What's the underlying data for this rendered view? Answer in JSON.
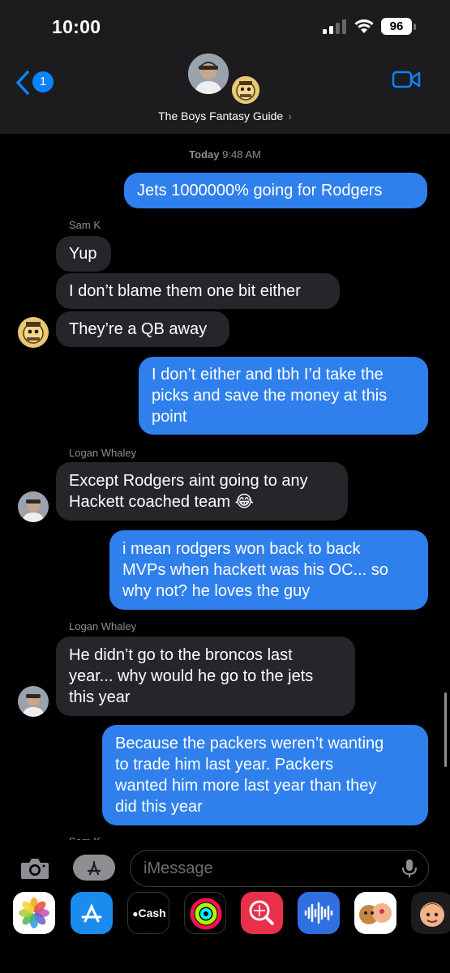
{
  "status_bar": {
    "time": "10:00",
    "battery": "96"
  },
  "header": {
    "back_badge": "1",
    "group_name": "The Boys Fantasy Guide",
    "chevron": "›"
  },
  "timestamp": {
    "day": "Today",
    "time": "9:48 AM"
  },
  "messages": [
    {
      "type": "out",
      "text": "Jets 1000000% going for Rodgers"
    },
    {
      "type": "sender",
      "name": "Sam K"
    },
    {
      "type": "in",
      "text": "Yup"
    },
    {
      "type": "in",
      "text": "I don’t blame them one bit either"
    },
    {
      "type": "in",
      "text": "They’re a QB away"
    },
    {
      "type": "out",
      "text": "I don’t either and tbh I’d take the\npicks and save the money at this\npoint"
    },
    {
      "type": "sender",
      "name": "Logan  Whaley"
    },
    {
      "type": "in",
      "text": "Except Rodgers aint going to any\nHackett coached team 😂"
    },
    {
      "type": "out",
      "text": "i mean rodgers won back to back\nMVPs when hackett was his OC... so\nwhy not? he loves the guy"
    },
    {
      "type": "sender",
      "name": "Logan  Whaley"
    },
    {
      "type": "in",
      "text": "He didn’t go to the broncos last\nyear... why would he go to the jets\nthis year"
    },
    {
      "type": "out",
      "text": "Because the packers weren’t wanting\nto trade him last year. Packers\nwanted him more last year than they\ndid this year"
    },
    {
      "type": "sender",
      "name": "Sam K"
    }
  ],
  "input": {
    "placeholder": "iMessage"
  },
  "app_tray": [
    {
      "icon": "photos-icon"
    },
    {
      "icon": "app-store-icon"
    },
    {
      "icon": "apple-cash-icon",
      "label": "Cash"
    },
    {
      "icon": "activity-icon"
    },
    {
      "icon": "image-search-icon"
    },
    {
      "icon": "audio-message-icon"
    },
    {
      "icon": "memoji-stickers-icon"
    },
    {
      "icon": "memoji-icon"
    }
  ],
  "colors": {
    "incoming_bubble": "#26252a",
    "outgoing_bubble": "#2f80ed",
    "accent": "#0a84ff",
    "header_bg": "#1c1c1e"
  }
}
